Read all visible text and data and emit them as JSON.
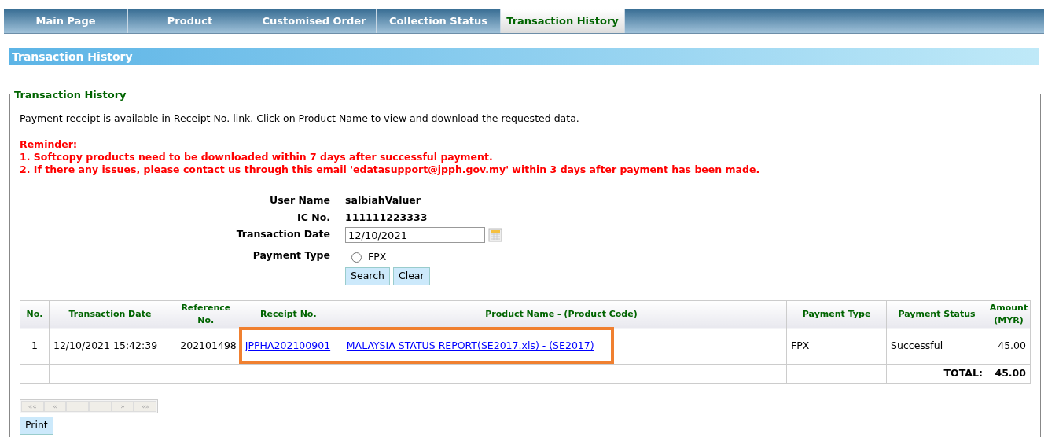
{
  "tabs": [
    {
      "label": "Main Page",
      "selected": false
    },
    {
      "label": "Product",
      "selected": false
    },
    {
      "label": "Customised Order",
      "selected": false
    },
    {
      "label": "Collection Status",
      "selected": false
    },
    {
      "label": "Transaction History",
      "selected": true
    }
  ],
  "section_title": "Transaction History",
  "fieldset": {
    "legend": "Transaction History",
    "info": "Payment receipt is available in Receipt No. link. Click on Product Name to view and download the requested data.",
    "reminder_title": "Reminder:",
    "reminders": [
      "1. Softcopy products need to be downloaded within 7 days after successful payment.",
      "2. If there any issues, please contact us through this email 'edatasupport@jpph.gov.my' within 3 days after payment has been made."
    ]
  },
  "form": {
    "user_name_label": "User Name",
    "user_name": "salbiahValuer",
    "ic_label": "IC No.",
    "ic": "111111223333",
    "date_label": "Transaction Date",
    "date_value": "12/10/2021",
    "payment_type_label": "Payment Type",
    "payment_options": [
      {
        "label": "FPX",
        "selected": false
      }
    ],
    "buttons": [
      "Search",
      "Clear"
    ]
  },
  "table": {
    "columns": [
      "No.",
      "Transaction Date",
      "Reference No.",
      "Receipt No.",
      "Product Name - (Product Code)",
      "Payment Type",
      "Payment Status",
      "Amount (MYR)"
    ],
    "rows": [
      {
        "no": "1",
        "date": "12/10/2021 15:42:39",
        "reference": "202101498",
        "receipt": "JPPHA202100901",
        "product": "MALAYSIA STATUS REPORT(SE2017.xls) - (SE2017)",
        "payment_type": "FPX",
        "status": "Successful",
        "amount": "45.00",
        "highlighted": true
      }
    ],
    "total_label": "TOTAL:",
    "total": "45.00"
  },
  "pager": {
    "first": "««",
    "previous": "«",
    "next": "»",
    "last": "»»"
  },
  "print_button": "Print"
}
